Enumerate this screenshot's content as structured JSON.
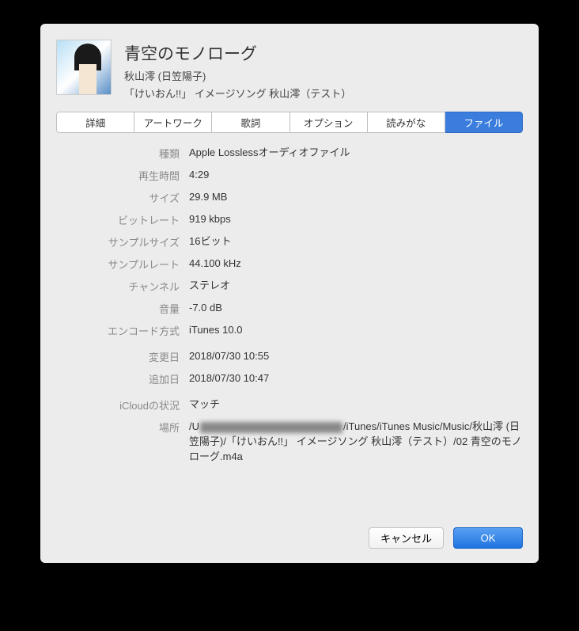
{
  "header": {
    "title": "青空のモノローグ",
    "artist": "秋山澪 (日笠陽子)",
    "album": "「けいおん!!」 イメージソング 秋山澪（テスト）"
  },
  "tabs": {
    "details": "詳細",
    "artwork": "アートワーク",
    "lyrics": "歌詞",
    "options": "オプション",
    "sorting": "読みがな",
    "file": "ファイル"
  },
  "fields": {
    "kind_label": "種類",
    "kind_value": "Apple Losslessオーディオファイル",
    "duration_label": "再生時間",
    "duration_value": "4:29",
    "size_label": "サイズ",
    "size_value": "29.9 MB",
    "bitrate_label": "ビットレート",
    "bitrate_value": "919 kbps",
    "samplesize_label": "サンプルサイズ",
    "samplesize_value": "16ビット",
    "samplerate_label": "サンプルレート",
    "samplerate_value": "44.100 kHz",
    "channels_label": "チャンネル",
    "channels_value": "ステレオ",
    "volume_label": "音量",
    "volume_value": "-7.0 dB",
    "encoder_label": "エンコード方式",
    "encoder_value": "iTunes 10.0",
    "modified_label": "変更日",
    "modified_value": "2018/07/30 10:55",
    "added_label": "追加日",
    "added_value": "2018/07/30 10:47",
    "icloud_label": "iCloudの状況",
    "icloud_value": "マッチ",
    "location_label": "場所",
    "location_prefix": "/U",
    "location_suffix": "/iTunes/iTunes Music/Music/秋山澪 (日笠陽子)/「けいおん!!」 イメージソング 秋山澪（テスト）/02 青空のモノローグ.m4a"
  },
  "buttons": {
    "cancel": "キャンセル",
    "ok": "OK"
  }
}
